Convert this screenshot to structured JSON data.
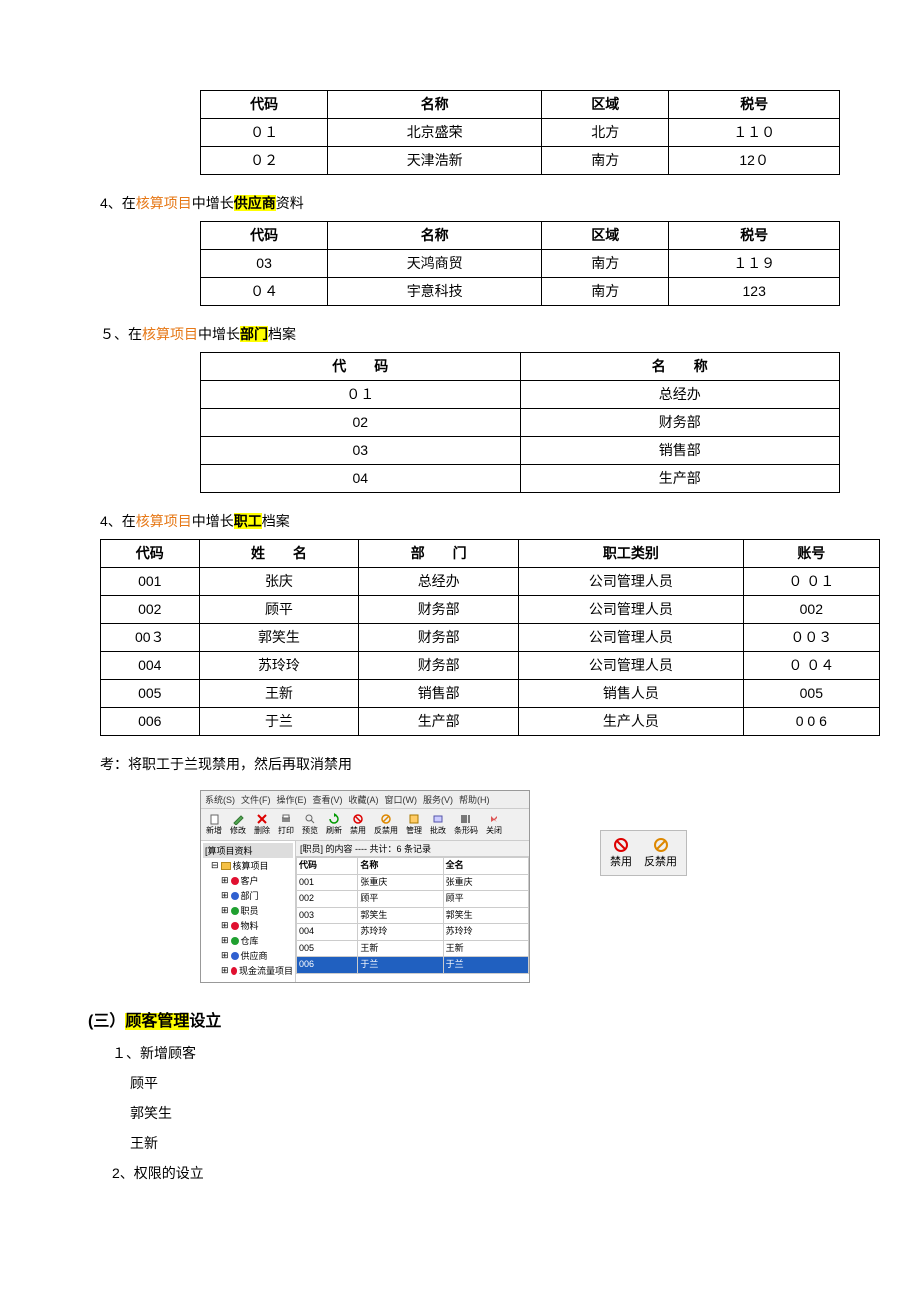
{
  "table1": {
    "headers": [
      "代码",
      "名称",
      "区域",
      "税号"
    ],
    "rows": [
      [
        "０１",
        "北京盛荣",
        "北方",
        "１１０"
      ],
      [
        "０２",
        "天津浩新",
        "南方",
        "12０"
      ]
    ]
  },
  "sec4a": {
    "prefix": "4、在",
    "orange": "核算项目",
    "mid": "中增长",
    "hl": "供应商",
    "suffix": "资料"
  },
  "table2": {
    "headers": [
      "代码",
      "名称",
      "区域",
      "税号"
    ],
    "rows": [
      [
        "03",
        "天鸿商贸",
        "南方",
        "１１９"
      ],
      [
        "０４",
        "宇意科技",
        "南方",
        "123"
      ]
    ]
  },
  "sec5": {
    "prefix": "５、在",
    "orange": "核算项目",
    "mid": "中增长",
    "hl": "部门",
    "suffix": "档案"
  },
  "table3": {
    "headers": [
      "代　　码",
      "名　　称"
    ],
    "rows": [
      [
        "０１",
        "总经办"
      ],
      [
        "02",
        "财务部"
      ],
      [
        "03",
        "销售部"
      ],
      [
        "04",
        "生产部"
      ]
    ]
  },
  "sec4b": {
    "prefix": "4、在",
    "orange": "核算项目",
    "mid": "中增长",
    "hl": "职工",
    "suffix": "档案"
  },
  "table4": {
    "headers": [
      "代码",
      "姓　　名",
      "部　　门",
      "职工类别",
      "账号"
    ],
    "rows": [
      [
        "001",
        "张庆",
        "总经办",
        "公司管理人员",
        "０ ０１"
      ],
      [
        "002",
        "顾平",
        "财务部",
        "公司管理人员",
        "002"
      ],
      [
        "00３",
        "郭笑生",
        "财务部",
        "公司管理人员",
        "００３"
      ],
      [
        "004",
        "苏玲玲",
        "财务部",
        "公司管理人员",
        "０ ０４"
      ],
      [
        "005",
        "王新",
        "销售部",
        "销售人员",
        "005"
      ],
      [
        "006",
        "于兰",
        "生产部",
        "生产人员",
        "0 0 6"
      ]
    ]
  },
  "note": "考：将职工于兰现禁用，然后再取消禁用",
  "app": {
    "menu": [
      "系统(S)",
      "文件(F)",
      "操作(E)",
      "查看(V)",
      "收藏(A)",
      "窗口(W)",
      "服务(V)",
      "帮助(H)"
    ],
    "toolbar": [
      {
        "label": "新增",
        "icon": "new"
      },
      {
        "label": "修改",
        "icon": "edit"
      },
      {
        "label": "删除",
        "icon": "del"
      },
      {
        "label": "打印",
        "icon": "print"
      },
      {
        "label": "预览",
        "icon": "preview"
      },
      {
        "label": "刷新",
        "icon": "refresh"
      },
      {
        "label": "禁用",
        "icon": "forbid"
      },
      {
        "label": "反禁用",
        "icon": "unforbid"
      },
      {
        "label": "管理",
        "icon": "manage"
      },
      {
        "label": "批改",
        "icon": "batch"
      },
      {
        "label": "条形码",
        "icon": "barcode"
      },
      {
        "label": "关闭",
        "icon": "close"
      }
    ],
    "tree_title": "[算项目资料",
    "tree_root": "核算项目",
    "tree_items": [
      {
        "label": "客户",
        "color": "#e01030"
      },
      {
        "label": "部门",
        "color": "#3060d0"
      },
      {
        "label": "职员",
        "color": "#20a030"
      },
      {
        "label": "物料",
        "color": "#e01030"
      },
      {
        "label": "仓库",
        "color": "#20a030"
      },
      {
        "label": "供应商",
        "color": "#3060d0"
      },
      {
        "label": "现金流量项目",
        "color": "#e01030"
      }
    ],
    "grid_header_text": "[职员] 的内容 ---- 共计：6 条记录",
    "grid_cols": [
      "代码",
      "名称",
      "全名"
    ],
    "grid_rows": [
      [
        "001",
        "张重庆",
        "张重庆"
      ],
      [
        "002",
        "顾平",
        "顾平"
      ],
      [
        "003",
        "郭笑生",
        "郭笑生"
      ],
      [
        "004",
        "苏玲玲",
        "苏玲玲"
      ],
      [
        "005",
        "王新",
        "王新"
      ],
      [
        "006",
        "于兰",
        "于兰"
      ]
    ]
  },
  "small": {
    "forbid": "禁用",
    "unforbid": "反禁用"
  },
  "section3": {
    "title_prefix": "(三）",
    "title_hl": "顾客管理",
    "title_suffix": "设立",
    "item1": "１、新增顾客",
    "names": [
      "顾平",
      "郭笑生",
      "王新"
    ],
    "item2": "2、权限的设立"
  }
}
